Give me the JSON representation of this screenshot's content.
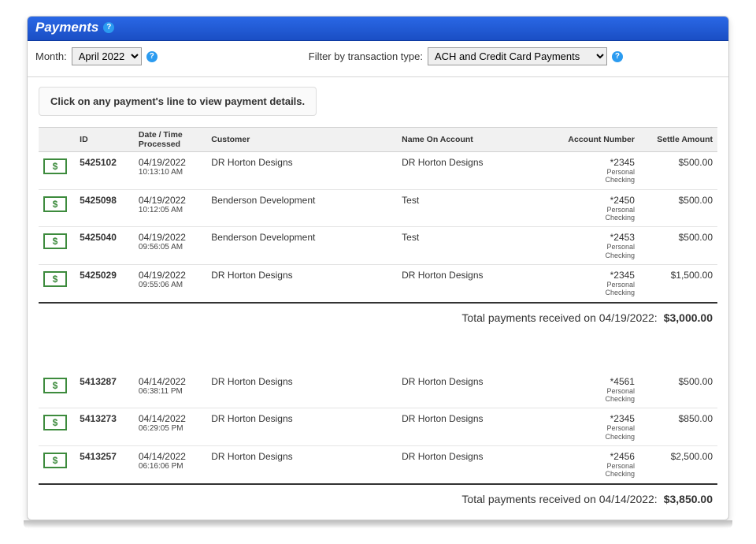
{
  "header": {
    "title": "Payments"
  },
  "filters": {
    "month_label": "Month:",
    "month_value": "April 2022",
    "type_label": "Filter by transaction type:",
    "type_value": "ACH and Credit Card Payments"
  },
  "info": "Click on any payment's line to view payment details.",
  "columns": {
    "id": "ID",
    "datetime": "Date / Time Processed",
    "customer": "Customer",
    "name_on_account": "Name On Account",
    "account_number": "Account Number",
    "settle_amount": "Settle Amount"
  },
  "groups": [
    {
      "date": "04/19/2022",
      "total_label": "Total payments received on 04/19/2022:",
      "total_value": "$3,000.00",
      "rows": [
        {
          "id": "5425102",
          "date": "04/19/2022",
          "time": "10:13:10 AM",
          "customer": "DR Horton Designs",
          "name": "DR Horton Designs",
          "acct": "*2345",
          "acct_type1": "Personal",
          "acct_type2": "Checking",
          "amount": "$500.00"
        },
        {
          "id": "5425098",
          "date": "04/19/2022",
          "time": "10:12:05 AM",
          "customer": "Benderson Development",
          "name": "Test",
          "acct": "*2450",
          "acct_type1": "Personal",
          "acct_type2": "Checking",
          "amount": "$500.00"
        },
        {
          "id": "5425040",
          "date": "04/19/2022",
          "time": "09:56:05 AM",
          "customer": "Benderson Development",
          "name": "Test",
          "acct": "*2453",
          "acct_type1": "Personal",
          "acct_type2": "Checking",
          "amount": "$500.00"
        },
        {
          "id": "5425029",
          "date": "04/19/2022",
          "time": "09:55:06 AM",
          "customer": "DR Horton Designs",
          "name": "DR Horton Designs",
          "acct": "*2345",
          "acct_type1": "Personal",
          "acct_type2": "Checking",
          "amount": "$1,500.00"
        }
      ]
    },
    {
      "date": "04/14/2022",
      "total_label": "Total payments received on 04/14/2022:",
      "total_value": "$3,850.00",
      "rows": [
        {
          "id": "5413287",
          "date": "04/14/2022",
          "time": "06:38:11 PM",
          "customer": "DR Horton Designs",
          "name": "DR Horton Designs",
          "acct": "*4561",
          "acct_type1": "Personal",
          "acct_type2": "Checking",
          "amount": "$500.00"
        },
        {
          "id": "5413273",
          "date": "04/14/2022",
          "time": "06:29:05 PM",
          "customer": "DR Horton Designs",
          "name": "DR Horton Designs",
          "acct": "*2345",
          "acct_type1": "Personal",
          "acct_type2": "Checking",
          "amount": "$850.00"
        },
        {
          "id": "5413257",
          "date": "04/14/2022",
          "time": "06:16:06 PM",
          "customer": "DR Horton Designs",
          "name": "DR Horton Designs",
          "acct": "*2456",
          "acct_type1": "Personal",
          "acct_type2": "Checking",
          "amount": "$2,500.00"
        }
      ]
    }
  ]
}
